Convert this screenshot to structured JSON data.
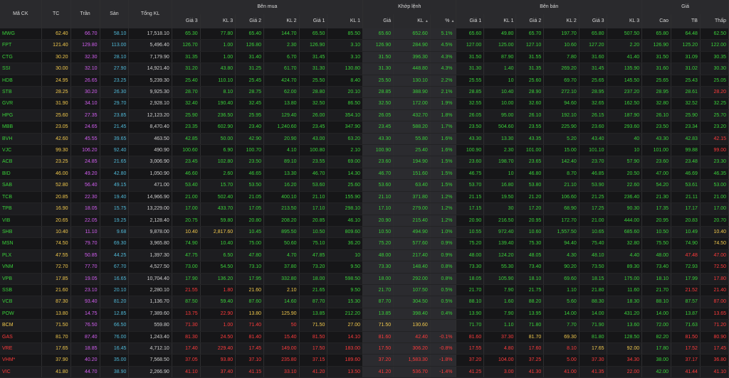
{
  "header": {
    "groups": {
      "symbol": "Mã CK",
      "ref": "TC",
      "ceiling": "Trần",
      "floor": "Sàn",
      "total_vol": "Tổng KL",
      "bid": "Bên mua",
      "match": "Khớp lệnh",
      "ask": "Bên bán",
      "price": "Giá"
    },
    "bid_cols": [
      "Giá 3",
      "KL 3",
      "Giá 2",
      "KL 2",
      "Giá 1",
      "KL 1"
    ],
    "match_cols": [
      "Giá",
      "KL",
      "%"
    ],
    "ask_cols": [
      "Giá 1",
      "KL 1",
      "Giá 2",
      "KL 2",
      "Giá 3",
      "KL 3"
    ],
    "price_cols": [
      "Cao",
      "TB",
      "Thấp"
    ]
  },
  "colors": {
    "up": "#3ad13a",
    "down": "#ff3b3b",
    "ref": "#f2c94c",
    "ceiling": "#d25ef0",
    "floor": "#4fb7d6"
  },
  "rows": [
    {
      "s": "MWG",
      "st": "u",
      "tc": "62.40",
      "tr": "66.70",
      "sa": "58.10",
      "t": "17,518.10",
      "b3": "65.30",
      "bk3": "77.80",
      "b2": "65.40",
      "bk2": "144.70",
      "b1": "65.50",
      "bk1": "85.50",
      "mp": "65.60",
      "mk": "652.60",
      "pc": "5.1%",
      "a1": "65.60",
      "ak1": "49.80",
      "a2": "65.70",
      "ak2": "197.70",
      "a3": "65.80",
      "ak3": "507.50",
      "hi": "65.80",
      "tb": "64.48",
      "lo": "62.50"
    },
    {
      "s": "FPT",
      "st": "u",
      "tc": "121.40",
      "tr": "129.80",
      "sa": "113.00",
      "t": "5,496.40",
      "b3": "126.70",
      "bk3": "1.00",
      "b2": "126.80",
      "bk2": "2.30",
      "b1": "126.90",
      "bk1": "3.10",
      "mp": "126.90",
      "mk": "284.90",
      "pc": "4.5%",
      "a1": "127.00",
      "ak1": "125.00",
      "a2": "127.10",
      "ak2": "10.60",
      "a3": "127.20",
      "ak3": "2.20",
      "hi": "126.90",
      "tb": "125.20",
      "lo": "122.00"
    },
    {
      "s": "CTG",
      "st": "u",
      "tc": "30.20",
      "tr": "32.30",
      "sa": "28.10",
      "t": "7,179.90",
      "b3": "31.35",
      "bk3": "1.00",
      "b2": "31.40",
      "bk2": "6.70",
      "b1": "31.45",
      "bk1": "3.10",
      "mp": "31.50",
      "mk": "396.30",
      "pc": "4.3%",
      "a1": "31.50",
      "ak1": "87.90",
      "a2": "31.55",
      "ak2": "7.80",
      "a3": "31.60",
      "ak3": "41.40",
      "hi": "31.50",
      "tb": "31.09",
      "lo": "30.35"
    },
    {
      "s": "SSI",
      "st": "u",
      "tc": "30.00",
      "tr": "32.10",
      "sa": "27.90",
      "t": "14,921.40",
      "b3": "31.20",
      "bk3": "43.80",
      "b2": "31.25",
      "bk2": "61.70",
      "b1": "31.30",
      "bk1": "130.80",
      "mp": "31.30",
      "mk": "448.80",
      "pc": "4.3%",
      "a1": "31.30",
      "ak1": "1.40",
      "a2": "31.35",
      "ak2": "269.20",
      "a3": "31.45",
      "ak3": "135.90",
      "hi": "31.60",
      "tb": "31.02",
      "lo": "30.30"
    },
    {
      "s": "HDB",
      "st": "u",
      "tc": "24.95",
      "tr": "26.65",
      "sa": "23.25",
      "t": "5,239.30",
      "b3": "25.40",
      "bk3": "110.10",
      "b2": "25.45",
      "bk2": "424.70",
      "b1": "25.50",
      "bk1": "8.40",
      "mp": "25.50",
      "mk": "130.10",
      "pc": "2.2%",
      "a1": "25.55",
      "ak1": "10",
      "a2": "25.60",
      "ak2": "69.70",
      "a3": "25.65",
      "ak3": "145.50",
      "hi": "25.65",
      "tb": "25.43",
      "lo": "25.05"
    },
    {
      "s": "STB",
      "st": "u",
      "tc": "28.25",
      "sa": "26.30",
      "tr": "30.20",
      "t": "9,925.30",
      "b3": "28.70",
      "bk3": "8.10",
      "b2": "28.75",
      "bk2": "62.00",
      "b1": "28.80",
      "bk1": "20.10",
      "mp": "28.85",
      "mk": "388.90",
      "pc": "2.1%",
      "a1": "28.85",
      "ak1": "10.40",
      "a2": "28.90",
      "ak2": "272.10",
      "a3": "28.95",
      "ak3": "237.20",
      "hi": "28.95",
      "tb": "28.61",
      "lo": "28.20"
    },
    {
      "s": "GVR",
      "st": "u",
      "tc": "31.90",
      "tr": "34.10",
      "sa": "29.70",
      "t": "2,928.10",
      "b3": "32.40",
      "bk3": "190.40",
      "b2": "32.45",
      "bk2": "13.80",
      "b1": "32.50",
      "bk1": "86.50",
      "mp": "32.50",
      "mk": "172.00",
      "pc": "1.9%",
      "a1": "32.55",
      "ak1": "10.00",
      "a2": "32.60",
      "ak2": "94.60",
      "a3": "32.65",
      "ak3": "162.50",
      "hi": "32.80",
      "tb": "32.52",
      "lo": "32.25"
    },
    {
      "s": "HPG",
      "st": "u",
      "tc": "25.60",
      "tr": "27.35",
      "sa": "23.85",
      "t": "12,123.20",
      "b3": "25.90",
      "bk3": "236.50",
      "b2": "25.95",
      "bk2": "129.40",
      "b1": "26.00",
      "bk1": "354.10",
      "mp": "26.05",
      "mk": "432.70",
      "pc": "1.8%",
      "a1": "26.05",
      "ak1": "95.00",
      "a2": "26.10",
      "ak2": "192.10",
      "a3": "26.15",
      "ak3": "187.90",
      "hi": "26.10",
      "tb": "25.90",
      "lo": "25.70"
    },
    {
      "s": "MBB",
      "st": "u",
      "tc": "23.05",
      "tr": "24.65",
      "sa": "21.45",
      "t": "8,470.40",
      "b3": "23.35",
      "bk3": "602.90",
      "b2": "23.40",
      "bk2": "1,240.60",
      "b1": "23.45",
      "bk1": "347.90",
      "mp": "23.45",
      "mk": "588.20",
      "pc": "1.7%",
      "a1": "23.50",
      "ak1": "504.60",
      "a2": "23.55",
      "ak2": "225.90",
      "a3": "23.60",
      "ak3": "293.60",
      "hi": "23.50",
      "tb": "23.34",
      "lo": "23.20"
    },
    {
      "s": "BVH",
      "st": "u",
      "tc": "42.60",
      "tr": "45.55",
      "sa": "39.65",
      "t": "463.50",
      "b3": "42.85",
      "bk3": "50.00",
      "b2": "42.90",
      "bk2": "20.90",
      "b1": "43.00",
      "bk1": "63.20",
      "mp": "43.30",
      "mk": "55.80",
      "pc": "1.6%",
      "a1": "43.30",
      "ak1": "13.30",
      "a2": "43.35",
      "ak2": "5.20",
      "a3": "43.40",
      "ak3": "40",
      "hi": "43.30",
      "tb": "42.83",
      "lo": "42.15"
    },
    {
      "s": "VJC",
      "st": "u",
      "tc": "99.30",
      "tr": "106.20",
      "sa": "92.40",
      "t": "490.90",
      "b3": "100.60",
      "bk3": "6.90",
      "b2": "100.70",
      "bk2": "4.10",
      "b1": "100.80",
      "bk1": "2.10",
      "mp": "100.90",
      "mk": "25.40",
      "pc": "1.6%",
      "a1": "100.90",
      "ak1": "2.30",
      "a2": "101.00",
      "ak2": "15.00",
      "a3": "101.10",
      "ak3": "10",
      "hi": "101.00",
      "tb": "99.88",
      "lo": "99.00"
    },
    {
      "s": "ACB",
      "st": "u",
      "tc": "23.25",
      "tr": "24.85",
      "sa": "21.65",
      "t": "3,006.90",
      "b3": "23.45",
      "bk3": "102.80",
      "b2": "23.50",
      "bk2": "89.10",
      "b1": "23.55",
      "bk1": "69.00",
      "mp": "23.60",
      "mk": "194.90",
      "pc": "1.5%",
      "a1": "23.60",
      "ak1": "198.70",
      "a2": "23.65",
      "ak2": "142.40",
      "a3": "23.70",
      "ak3": "57.90",
      "hi": "23.60",
      "tb": "23.48",
      "lo": "23.30"
    },
    {
      "s": "BID",
      "st": "u",
      "tc": "46.00",
      "tr": "49.20",
      "sa": "42.80",
      "t": "1,050.90",
      "b3": "46.60",
      "bk3": "2.60",
      "b2": "46.65",
      "bk2": "13.30",
      "b1": "46.70",
      "bk1": "14.30",
      "mp": "46.70",
      "mk": "151.60",
      "pc": "1.5%",
      "a1": "46.75",
      "ak1": "10",
      "a2": "46.80",
      "ak2": "8.70",
      "a3": "46.85",
      "ak3": "20.50",
      "hi": "47.00",
      "tb": "46.69",
      "lo": "46.35"
    },
    {
      "s": "SAB",
      "st": "u",
      "tc": "52.80",
      "tr": "56.40",
      "sa": "49.15",
      "t": "471.00",
      "b3": "53.40",
      "bk3": "15.70",
      "b2": "53.50",
      "bk2": "16.20",
      "b1": "53.60",
      "bk1": "25.60",
      "mp": "53.60",
      "mk": "63.40",
      "pc": "1.5%",
      "a1": "53.70",
      "ak1": "16.80",
      "a2": "53.80",
      "ak2": "21.10",
      "a3": "53.90",
      "ak3": "22.60",
      "hi": "54.20",
      "tb": "53.61",
      "lo": "53.00"
    },
    {
      "s": "TCB",
      "st": "u",
      "tc": "20.85",
      "tr": "22.30",
      "sa": "19.40",
      "t": "14,966.90",
      "b3": "21.00",
      "bk3": "502.40",
      "b2": "21.05",
      "bk2": "400.10",
      "b1": "21.10",
      "bk1": "155.90",
      "mp": "21.10",
      "mk": "371.80",
      "pc": "1.2%",
      "a1": "21.15",
      "ak1": "19.50",
      "a2": "21.20",
      "ak2": "106.60",
      "a3": "21.25",
      "ak3": "236.40",
      "hi": "21.30",
      "tb": "21.11",
      "lo": "21.00"
    },
    {
      "s": "TPB",
      "st": "u",
      "tc": "16.90",
      "tr": "18.05",
      "sa": "15.75",
      "t": "13,229.00",
      "b3": "17.00",
      "bk3": "433.70",
      "b2": "17.05",
      "bk2": "213.50",
      "b1": "17.10",
      "bk1": "298.10",
      "mp": "17.10",
      "mk": "279.00",
      "pc": "1.2%",
      "a1": "17.15",
      "ak1": "30",
      "a2": "17.20",
      "ak2": "68.90",
      "a3": "17.25",
      "ak3": "90.30",
      "hi": "17.35",
      "tb": "17.17",
      "lo": "17.00"
    },
    {
      "s": "VIB",
      "st": "u",
      "tc": "20.65",
      "tr": "22.05",
      "sa": "19.25",
      "t": "2,128.40",
      "b3": "20.75",
      "bk3": "59.80",
      "b2": "20.80",
      "bk2": "208.20",
      "b1": "20.85",
      "bk1": "46.10",
      "mp": "20.90",
      "mk": "215.40",
      "pc": "1.2%",
      "a1": "20.90",
      "ak1": "216.50",
      "a2": "20.95",
      "ak2": "172.70",
      "a3": "21.00",
      "ak3": "444.00",
      "hi": "20.95",
      "tb": "20.83",
      "lo": "20.70"
    },
    {
      "s": "SHB",
      "st": "u",
      "tc": "10.40",
      "tr": "11.10",
      "sa": "9.68",
      "t": "9,878.00",
      "b3": "10.40",
      "bk3": "2,817.60",
      "b2": "10.45",
      "bk2": "895.50",
      "b1": "10.50",
      "bk1": "809.60",
      "mp": "10.50",
      "mk": "494.90",
      "pc": "1.0%",
      "a1": "10.55",
      "ak1": "972.40",
      "a2": "10.60",
      "ak2": "1,557.50",
      "a3": "10.65",
      "ak3": "685.60",
      "hi": "10.50",
      "tb": "10.49",
      "lo": "10.40"
    },
    {
      "s": "MSN",
      "st": "u",
      "tc": "74.50",
      "tr": "79.70",
      "sa": "69.30",
      "t": "3,965.80",
      "b3": "74.90",
      "bk3": "10.40",
      "b2": "75.00",
      "bk2": "50.60",
      "b1": "75.10",
      "bk1": "36.20",
      "mp": "75.20",
      "mk": "577.60",
      "pc": "0.9%",
      "a1": "75.20",
      "ak1": "139.40",
      "a2": "75.30",
      "ak2": "94.40",
      "a3": "75.40",
      "ak3": "32.80",
      "hi": "75.50",
      "tb": "74.90",
      "lo": "74.50"
    },
    {
      "s": "PLX",
      "st": "u",
      "tc": "47.55",
      "tr": "50.85",
      "sa": "44.25",
      "t": "1,397.30",
      "b3": "47.75",
      "bk3": "6.50",
      "b2": "47.80",
      "bk2": "4.70",
      "b1": "47.85",
      "bk1": "10",
      "mp": "48.00",
      "mk": "217.40",
      "pc": "0.9%",
      "a1": "48.00",
      "ak1": "124.20",
      "a2": "48.05",
      "ak2": "4.30",
      "a3": "48.10",
      "ak3": "4.40",
      "hi": "48.00",
      "tb": "47.48",
      "lo": "47.00"
    },
    {
      "s": "VNM",
      "st": "u",
      "tc": "72.70",
      "tr": "77.70",
      "sa": "67.70",
      "t": "4,527.50",
      "b3": "73.00",
      "bk3": "54.50",
      "b2": "73.10",
      "bk2": "37.80",
      "b1": "73.20",
      "bk1": "9.50",
      "mp": "73.30",
      "mk": "148.40",
      "pc": "0.8%",
      "a1": "73.30",
      "ak1": "55.30",
      "a2": "73.40",
      "ak2": "90.20",
      "a3": "73.50",
      "ak3": "89.30",
      "hi": "73.40",
      "tb": "72.93",
      "lo": "72.50"
    },
    {
      "s": "VPB",
      "st": "u",
      "tc": "17.85",
      "tr": "19.05",
      "sa": "16.65",
      "t": "10,704.40",
      "b3": "17.90",
      "bk3": "136.20",
      "b2": "17.95",
      "bk2": "332.80",
      "b1": "18.00",
      "bk1": "598.50",
      "mp": "18.00",
      "mk": "292.00",
      "pc": "0.8%",
      "a1": "18.05",
      "ak1": "105.90",
      "a2": "18.10",
      "ak2": "69.60",
      "a3": "18.15",
      "ak3": "175.00",
      "hi": "18.10",
      "tb": "17.99",
      "lo": "17.80"
    },
    {
      "s": "SSB",
      "st": "u",
      "tc": "21.60",
      "tr": "23.10",
      "sa": "20.10",
      "t": "2,280.10",
      "b3": "21.55",
      "bk3": "1.80",
      "b2": "21.60",
      "bk2": "2.10",
      "b1": "21.65",
      "bk1": "9.50",
      "mp": "21.70",
      "mk": "107.50",
      "pc": "0.5%",
      "a1": "21.70",
      "ak1": "7.90",
      "a2": "21.75",
      "ak2": "1.10",
      "a3": "21.80",
      "ak3": "11.60",
      "hi": "21.70",
      "tb": "21.52",
      "lo": "21.40"
    },
    {
      "s": "VCB",
      "st": "u",
      "tc": "87.30",
      "tr": "93.40",
      "sa": "81.20",
      "t": "1,136.70",
      "b3": "87.50",
      "bk3": "59.40",
      "b2": "87.60",
      "bk2": "14.60",
      "b1": "87.70",
      "bk1": "15.30",
      "mp": "87.70",
      "mk": "304.50",
      "pc": "0.5%",
      "a1": "88.10",
      "ak1": "1.60",
      "a2": "88.20",
      "ak2": "5.60",
      "a3": "88.30",
      "ak3": "18.30",
      "hi": "88.10",
      "tb": "87.57",
      "lo": "87.00"
    },
    {
      "s": "POW",
      "st": "u",
      "tc": "13.80",
      "tr": "14.75",
      "sa": "12.85",
      "t": "7,389.60",
      "b3": "13.75",
      "bk3": "22.90",
      "b2": "13.80",
      "bk2": "125.90",
      "b1": "13.85",
      "bk1": "212.20",
      "mp": "13.85",
      "mk": "398.40",
      "pc": "0.4%",
      "a1": "13.90",
      "ak1": "7.90",
      "a2": "13.95",
      "ak2": "14.00",
      "a3": "14.00",
      "ak3": "431.20",
      "hi": "14.00",
      "tb": "13.87",
      "lo": "13.65"
    },
    {
      "s": "BCM",
      "st": "r",
      "tc": "71.50",
      "tr": "76.50",
      "sa": "66.50",
      "t": "559.80",
      "b3": "71.30",
      "bk3": "1.00",
      "b2": "71.40",
      "bk2": "50",
      "b1": "71.50",
      "bk1": "27.00",
      "mp": "71.50",
      "mk": "130.60",
      "pc": "",
      "a1": "71.70",
      "ak1": "1.10",
      "a2": "71.80",
      "ak2": "7.70",
      "a3": "71.90",
      "ak3": "13.60",
      "hi": "72.00",
      "tb": "71.63",
      "lo": "71.20"
    },
    {
      "s": "GAS",
      "st": "d",
      "tc": "81.70",
      "tr": "87.40",
      "sa": "76.00",
      "t": "1,243.40",
      "b3": "81.30",
      "bk3": "24.50",
      "b2": "81.40",
      "bk2": "15.40",
      "b1": "81.50",
      "bk1": "14.10",
      "mp": "81.60",
      "mk": "42.40",
      "pc": "-0.1%",
      "a1": "81.60",
      "ak1": "37.30",
      "a2": "81.70",
      "ak2": "69.30",
      "a3": "81.80",
      "ak3": "128.50",
      "hi": "82.20",
      "tb": "81.50",
      "lo": "80.90"
    },
    {
      "s": "VRE",
      "st": "d",
      "tc": "17.65",
      "tr": "18.85",
      "sa": "16.45",
      "t": "4,712.10",
      "b3": "17.40",
      "bk3": "229.40",
      "b2": "17.45",
      "bk2": "149.00",
      "b1": "17.50",
      "bk1": "183.00",
      "mp": "17.50",
      "mk": "306.20",
      "pc": "-0.8%",
      "a1": "17.55",
      "ak1": "4.80",
      "a2": "17.60",
      "ak2": "8.10",
      "a3": "17.65",
      "ak3": "92.00",
      "hi": "17.80",
      "tb": "17.52",
      "lo": "17.45"
    },
    {
      "s": "VHM*",
      "st": "d",
      "tc": "37.90",
      "tr": "40.20",
      "sa": "35.00",
      "t": "7,568.50",
      "b3": "37.05",
      "bk3": "93.80",
      "b2": "37.10",
      "bk2": "235.80",
      "b1": "37.15",
      "bk1": "189.60",
      "mp": "37.20",
      "mk": "1,583.30",
      "pc": "-1.8%",
      "a1": "37.20",
      "ak1": "104.00",
      "a2": "37.25",
      "ak2": "5.00",
      "a3": "37.30",
      "ak3": "34.30",
      "hi": "38.00",
      "tb": "37.17",
      "lo": "36.80"
    },
    {
      "s": "VIC",
      "st": "d",
      "tc": "41.80",
      "tr": "44.70",
      "sa": "38.90",
      "t": "2,266.90",
      "b3": "41.10",
      "bk3": "37.40",
      "b2": "41.15",
      "bk2": "33.10",
      "b1": "41.20",
      "bk1": "13.50",
      "mp": "41.20",
      "mk": "536.70",
      "pc": "-1.4%",
      "a1": "41.25",
      "ak1": "3.00",
      "a2": "41.30",
      "ak2": "41.00",
      "a3": "41.35",
      "ak3": "22.00",
      "hi": "42.00",
      "tb": "41.44",
      "lo": "41.10"
    }
  ]
}
